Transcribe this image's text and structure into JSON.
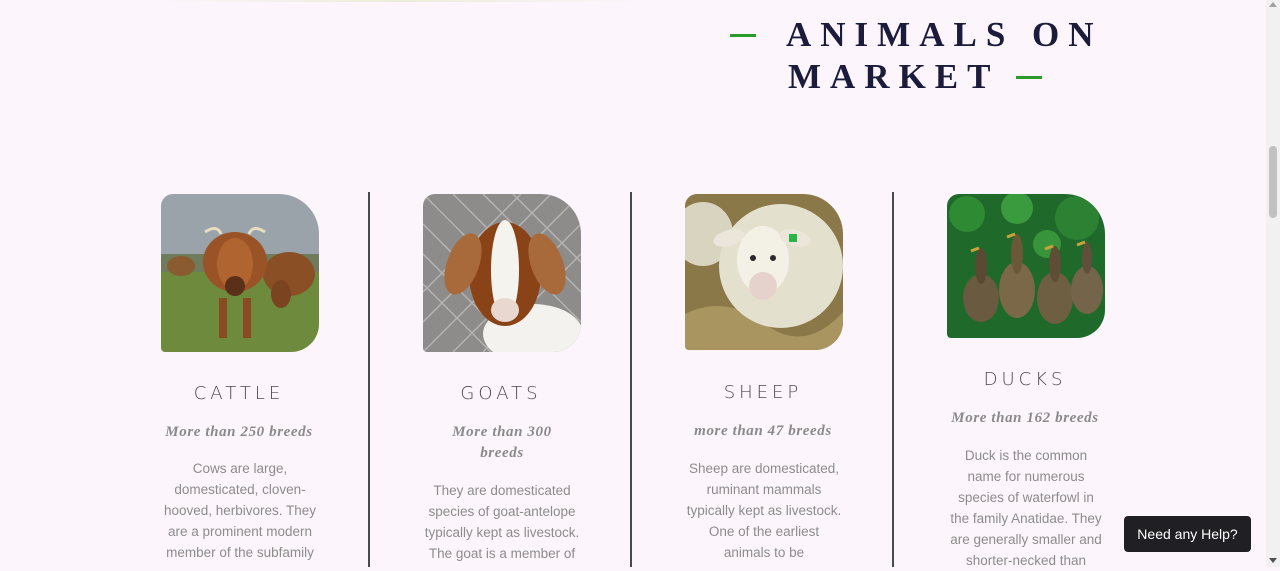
{
  "section": {
    "title_line1": "ANIMALS ON",
    "title_line2": "MARKET",
    "accent_color": "#2a9a2a"
  },
  "cards": [
    {
      "name": "CATTLE",
      "breeds": "More than 250 breeds",
      "description": "Cows are large, domesticated, cloven-hooved, herbivores. They are a prominent modern member of the subfamily",
      "image_icon": "cattle-photo"
    },
    {
      "name": "GOATS",
      "breeds": "More than 300 breeds",
      "description": "They are domesticated species of goat-antelope typically kept as livestock. The goat is a member of",
      "image_icon": "goat-photo"
    },
    {
      "name": "SHEEP",
      "breeds": "more than 47 breeds",
      "description": "Sheep are domesticated, ruminant mammals typically kept as livestock. One of the earliest animals to be",
      "image_icon": "sheep-photo"
    },
    {
      "name": "DUCKS",
      "breeds": "More than 162 breeds",
      "description": "Duck is the common name for numerous species of waterfowl in the family Anatidae. They are generally smaller and shorter-necked than",
      "image_icon": "duck-photo"
    }
  ],
  "help": {
    "label": "Need any Help?"
  }
}
